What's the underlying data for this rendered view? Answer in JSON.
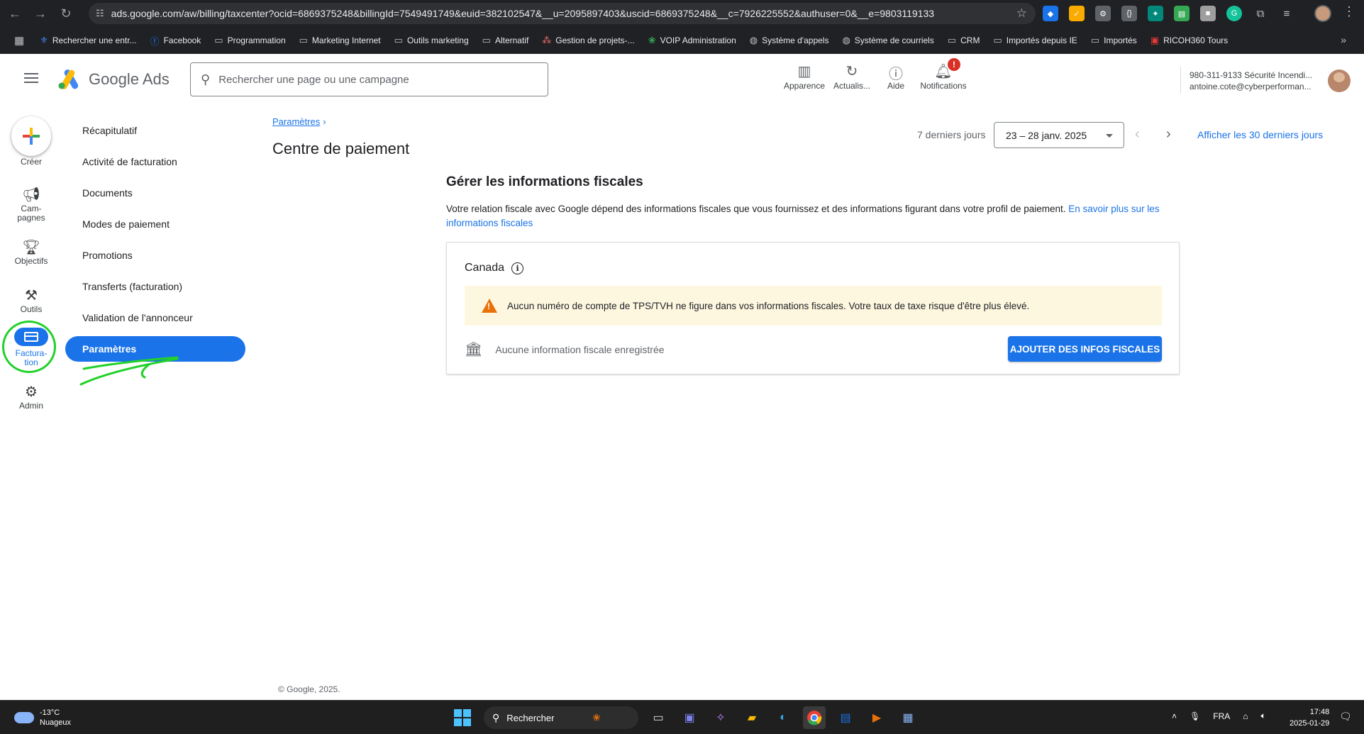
{
  "browser": {
    "url": "ads.google.com/aw/billing/taxcenter?ocid=6869375248&billingId=7549491749&euid=382102547&__u=2095897403&uscid=6869375248&__c=7926225552&authuser=0&__e=9803119133",
    "bookmarks": [
      {
        "label": "Rechercher une entr...",
        "icon": "quebec-flag-icon"
      },
      {
        "label": "Facebook",
        "icon": "facebook-icon"
      },
      {
        "label": "Programmation",
        "icon": "folder-icon"
      },
      {
        "label": "Marketing Internet",
        "icon": "folder-icon"
      },
      {
        "label": "Outils marketing",
        "icon": "folder-icon"
      },
      {
        "label": "Alternatif",
        "icon": "folder-icon"
      },
      {
        "label": "Gestion de projets-...",
        "icon": "asana-icon"
      },
      {
        "label": "VOIP Administration",
        "icon": "voip-icon"
      },
      {
        "label": "Système d'appels",
        "icon": "globe-icon"
      },
      {
        "label": "Système de courriels",
        "icon": "globe-icon"
      },
      {
        "label": "CRM",
        "icon": "folder-icon"
      },
      {
        "label": "Importés depuis IE",
        "icon": "folder-icon"
      },
      {
        "label": "Importés",
        "icon": "folder-icon"
      },
      {
        "label": "RICOH360 Tours",
        "icon": "ricoh-icon"
      }
    ]
  },
  "header": {
    "product": "Google Ads",
    "search_placeholder": "Rechercher une page ou une campagne",
    "tools": [
      {
        "label": "Apparence",
        "icon": "appearance-icon"
      },
      {
        "label": "Actualis...",
        "icon": "refresh-icon"
      },
      {
        "label": "Aide",
        "icon": "help-icon"
      },
      {
        "label": "Notifications",
        "icon": "bell-icon",
        "badge": "!"
      }
    ],
    "account_line1": "980-311-9133 Sécurité Incendi...",
    "account_line2": "antoine.cote@cyberperforman..."
  },
  "rail": {
    "create": "Créer",
    "items": [
      {
        "label": "Cam-\npagnes",
        "icon": "megaphone-icon"
      },
      {
        "label": "Objectifs",
        "icon": "trophy-icon"
      },
      {
        "label": "Outils",
        "icon": "tools-icon"
      },
      {
        "label": "Factura-\ntion",
        "icon": "billing-card-icon",
        "active": true
      },
      {
        "label": "Admin",
        "icon": "gear-icon"
      }
    ]
  },
  "subnav": {
    "items": [
      "Récapitulatif",
      "Activité de facturation",
      "Documents",
      "Modes de paiement",
      "Promotions",
      "Transferts (facturation)",
      "Validation de l'annonceur",
      "Paramètres"
    ],
    "active_index": 7
  },
  "main": {
    "breadcrumb": "Paramètres",
    "title": "Centre de paiement",
    "date_label": "7 derniers jours",
    "date_range": "23 – 28 janv. 2025",
    "show_30": "Afficher les 30 derniers jours",
    "section_title": "Gérer les informations fiscales",
    "section_desc": "Votre relation fiscale avec Google dépend des informations fiscales que vous fournissez et des informations figurant dans votre profil de paiement.",
    "learn_more": "En savoir plus sur les informations fiscales",
    "country": "Canada",
    "warning": "Aucun numéro de compte de TPS/TVH ne figure dans vos informations fiscales. Votre taux de taxe risque d'être plus élevé.",
    "no_info": "Aucune information fiscale enregistrée",
    "add_button": "AJOUTER DES INFOS FISCALES",
    "footer": "© Google, 2025."
  },
  "taskbar": {
    "temperature": "-13°C",
    "weather": "Nuageux",
    "search": "Rechercher",
    "lang": "FRA",
    "time": "17:48",
    "date": "2025-01-29"
  },
  "colors": {
    "accent": "#1a73e8",
    "warning": "#e8710a",
    "warning_bg": "#fef7e0",
    "annotation": "#22d12a"
  }
}
